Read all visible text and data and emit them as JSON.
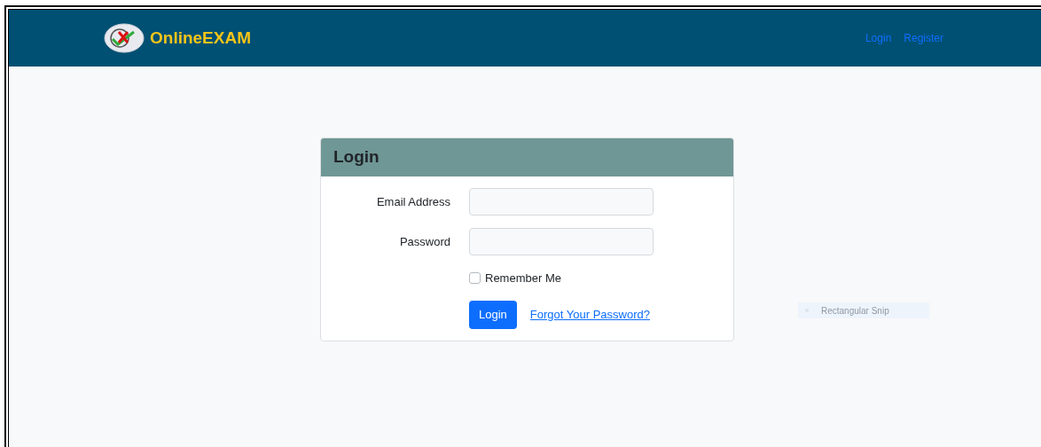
{
  "navbar": {
    "brand": "OnlineEXAM",
    "links": [
      {
        "label": "Login"
      },
      {
        "label": "Register"
      }
    ]
  },
  "login_card": {
    "title": "Login",
    "fields": [
      {
        "label": "Email Address"
      },
      {
        "label": "Password"
      }
    ],
    "remember_me": {
      "label": "Remember Me",
      "checked": false
    },
    "submit": "Login",
    "forgot_link": "Forgot Your Password?"
  },
  "snip_overlay": {
    "label": "Rectangular Snip"
  }
}
